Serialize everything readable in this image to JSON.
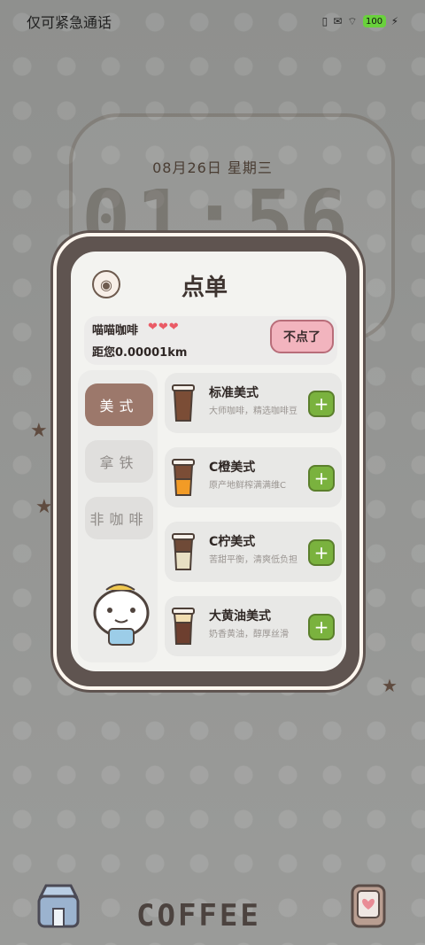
{
  "status_bar": {
    "left_text": "仅可紧急通话",
    "battery": "100"
  },
  "lockscreen": {
    "date": "08月26日 星期三",
    "time": "01:56"
  },
  "order_card": {
    "title": "点单",
    "store_name": "喵喵咖啡",
    "rating_hearts": "❤❤❤",
    "distance": "距您0.00001km",
    "not_order_label": "不点了"
  },
  "categories": [
    {
      "label": "美式",
      "active": true
    },
    {
      "label": "拿铁",
      "active": false
    },
    {
      "label": "非咖啡",
      "active": false
    }
  ],
  "items": [
    {
      "name": "标准美式",
      "desc": "大师咖啡，精选咖啡豆",
      "add_icon": "plus-icon"
    },
    {
      "name": "C橙美式",
      "desc": "原产地鲜榨满满维C",
      "add_icon": "plus-icon"
    },
    {
      "name": "C柠美式",
      "desc": "苦甜平衡，清爽低负担",
      "add_icon": "plus-icon"
    },
    {
      "name": "大黄油美式",
      "desc": "奶香黄油，醇厚丝滑",
      "add_icon": "plus-icon"
    }
  ],
  "dock": {
    "center_text": "COFFEE"
  }
}
